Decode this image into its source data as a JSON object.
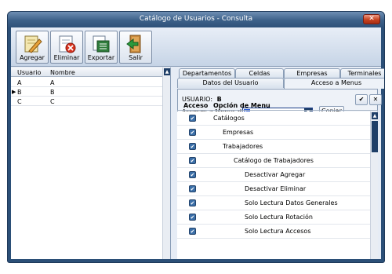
{
  "window": {
    "title": "Catálogo de Usuarios - Consulta",
    "close_glyph": "✕"
  },
  "toolbar": {
    "buttons": [
      {
        "id": "agregar",
        "label": "Agregar",
        "icon": "edit-icon"
      },
      {
        "id": "eliminar",
        "label": "Eliminar",
        "icon": "delete-icon"
      },
      {
        "id": "exportar",
        "label": "Exportar",
        "icon": "export-icon"
      },
      {
        "id": "salir",
        "label": "Salir",
        "icon": "exit-icon"
      }
    ]
  },
  "users_grid": {
    "columns": [
      "Usuario",
      "Nombre"
    ],
    "rows": [
      {
        "usuario": "A",
        "nombre": "A",
        "selected": false
      },
      {
        "usuario": "B",
        "nombre": "B",
        "selected": true
      },
      {
        "usuario": "C",
        "nombre": "C",
        "selected": false
      }
    ],
    "selected_indicator": "▶"
  },
  "tabs": {
    "row1": [
      "Departamentos",
      "Celdas",
      "Empresas",
      "Terminales"
    ],
    "row2": [
      "Datos del Usuario",
      "Acceso a Menus"
    ],
    "active": "Acceso a Menus"
  },
  "access_panel": {
    "usuario_label": "USUARIO:",
    "usuario_value": "B",
    "accesos_label": "Accesos a Menus de:",
    "accesos_value": "C",
    "copiar_label": "Copiar",
    "ok_glyph": "✔",
    "cancel_glyph": "✕",
    "columns": [
      "Acceso",
      "Opción de Menu"
    ],
    "menu_items": [
      {
        "name": "Catálogos",
        "level": 0,
        "checked": true
      },
      {
        "name": "Empresas",
        "level": 1,
        "checked": true
      },
      {
        "name": "Trabajadores",
        "level": 1,
        "checked": true
      },
      {
        "name": "Catálogo de Trabajadores",
        "level": 2,
        "checked": true
      },
      {
        "name": "Desactivar Agregar",
        "level": 3,
        "checked": true
      },
      {
        "name": "Desactivar Eliminar",
        "level": 3,
        "checked": true
      },
      {
        "name": "Solo Lectura Datos Generales",
        "level": 3,
        "checked": true
      },
      {
        "name": "Solo Lectura Rotación",
        "level": 3,
        "checked": true
      },
      {
        "name": "Solo Lectura Accesos",
        "level": 3,
        "checked": true
      }
    ],
    "check_glyph": "✔"
  },
  "colors": {
    "title_bar": "#3c6088",
    "scroll_thumb": "#1f3f68",
    "checkbox": "#3b6fa8"
  }
}
